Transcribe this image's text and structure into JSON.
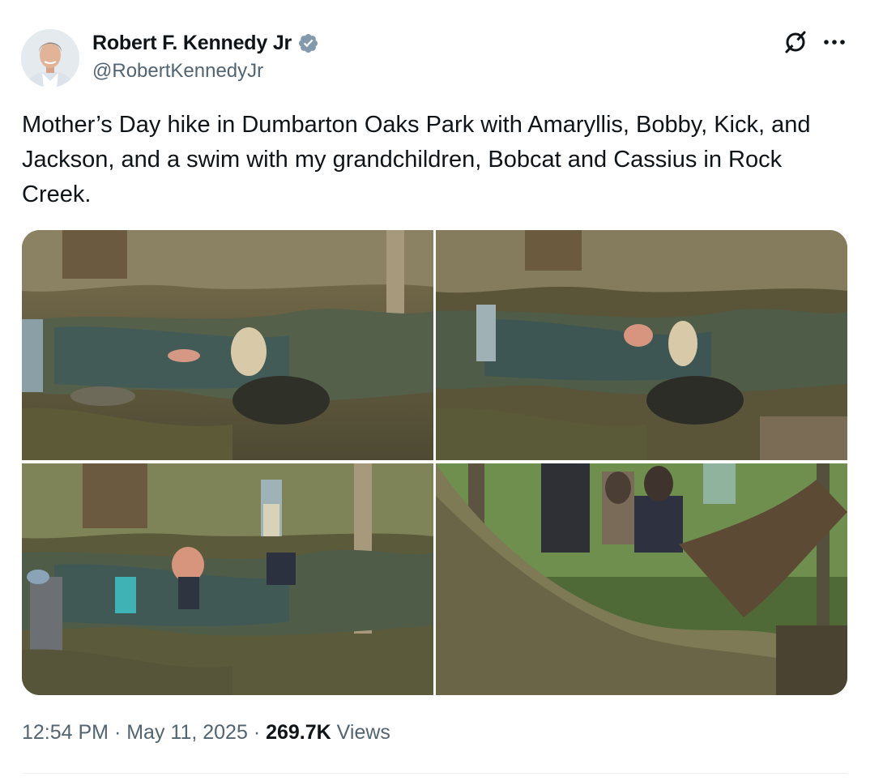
{
  "author": {
    "display_name": "Robert F. Kennedy Jr",
    "handle": "@RobertKennedyJr",
    "verified": true,
    "avatar_icon": "profile-photo"
  },
  "header_actions": {
    "grok_icon": "grok-icon",
    "more_icon": "more-horizontal-icon"
  },
  "tweet": {
    "text": "Mother’s Day hike in Dumbarton Oaks Park with Amaryllis, Bobby, Kick, and Jackson, and a swim with my grandchildren, Bobcat and Cassius in Rock Creek."
  },
  "media": {
    "count": 4,
    "photos": [
      {
        "subject": "creek-stones-child-swimmer"
      },
      {
        "subject": "creek-adult-child-water"
      },
      {
        "subject": "creek-family-standing"
      },
      {
        "subject": "fallen-tree-family-sitting"
      }
    ]
  },
  "meta": {
    "time": "12:54 PM",
    "sep1": " · ",
    "date": "May 11, 2025",
    "sep2": " · ",
    "views_count": "269.7K",
    "views_label": " Views"
  },
  "colors": {
    "text": "#0f1419",
    "secondary": "#536471",
    "verified_badge": "#829aab",
    "divider": "#eff3f4"
  }
}
